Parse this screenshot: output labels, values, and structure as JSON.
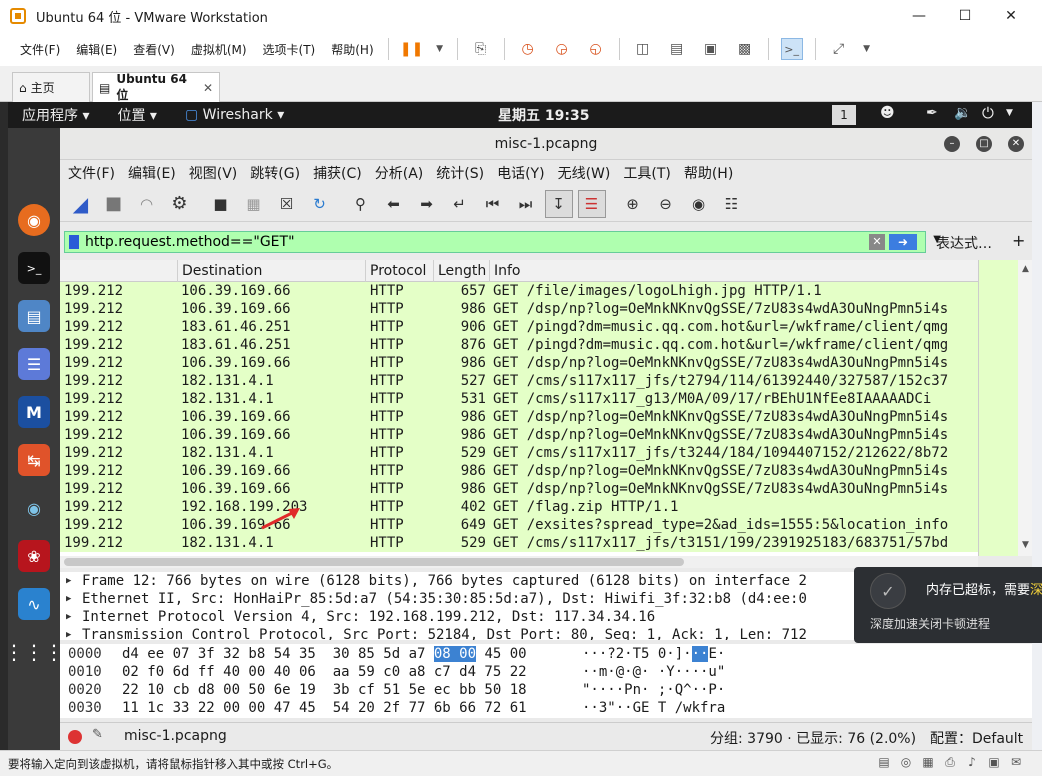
{
  "vmware": {
    "window_title": "Ubuntu 64 位 - VMware Workstation",
    "menu": [
      "文件(F)",
      "编辑(E)",
      "查看(V)",
      "虚拟机(M)",
      "选项卡(T)",
      "帮助(H)"
    ],
    "tabs": [
      {
        "label": "主页",
        "icon": "home-icon"
      },
      {
        "label": "Ubuntu 64 位",
        "icon": "vm-icon"
      }
    ],
    "status_hint": "要将输入定向到该虚拟机，请将鼠标指针移入其中或按 Ctrl+G。"
  },
  "ubuntu": {
    "applications": "应用程序 ▾",
    "places": "位置 ▾",
    "active_app": "Wireshark ▾",
    "clock": "星期五 19:35",
    "workspace": "1"
  },
  "wireshark": {
    "title": "misc-1.pcapng",
    "menu": [
      "文件(F)",
      "编辑(E)",
      "视图(V)",
      "跳转(G)",
      "捕获(C)",
      "分析(A)",
      "统计(S)",
      "电话(Y)",
      "无线(W)",
      "工具(T)",
      "帮助(H)"
    ],
    "filter": {
      "value": "http.request.method==\"GET\"",
      "expression_label": "表达式…",
      "add_label": "+"
    },
    "columns": [
      "Destination",
      "Protocol",
      "Length",
      "Info"
    ],
    "packets": [
      {
        "src": "199.212",
        "dst": "106.39.169.66",
        "proto": "HTTP",
        "len": "657",
        "info": "GET /file/images/logoLhigh.jpg HTTP/1.1"
      },
      {
        "src": "199.212",
        "dst": "106.39.169.66",
        "proto": "HTTP",
        "len": "986",
        "info": "GET /dsp/np?log=OeMnkNKnvQgSSE/7zU83s4wdA3OuNngPmn5i4s"
      },
      {
        "src": "199.212",
        "dst": "183.61.46.251",
        "proto": "HTTP",
        "len": "906",
        "info": "GET /pingd?dm=music.qq.com.hot&url=/wkframe/client/qmg"
      },
      {
        "src": "199.212",
        "dst": "183.61.46.251",
        "proto": "HTTP",
        "len": "876",
        "info": "GET /pingd?dm=music.qq.com.hot&url=/wkframe/client/qmg"
      },
      {
        "src": "199.212",
        "dst": "106.39.169.66",
        "proto": "HTTP",
        "len": "986",
        "info": "GET /dsp/np?log=OeMnkNKnvQgSSE/7zU83s4wdA3OuNngPmn5i4s"
      },
      {
        "src": "199.212",
        "dst": "182.131.4.1",
        "proto": "HTTP",
        "len": "527",
        "info": "GET /cms/s117x117_jfs/t2794/114/61392440/327587/152c37"
      },
      {
        "src": "199.212",
        "dst": "182.131.4.1",
        "proto": "HTTP",
        "len": "531",
        "info": "GET /cms/s117x117_g13/M0A/09/17/rBEhU1NfEe8IAAAAADCi"
      },
      {
        "src": "199.212",
        "dst": "106.39.169.66",
        "proto": "HTTP",
        "len": "986",
        "info": "GET /dsp/np?log=OeMnkNKnvQgSSE/7zU83s4wdA3OuNngPmn5i4s"
      },
      {
        "src": "199.212",
        "dst": "106.39.169.66",
        "proto": "HTTP",
        "len": "986",
        "info": "GET /dsp/np?log=OeMnkNKnvQgSSE/7zU83s4wdA3OuNngPmn5i4s"
      },
      {
        "src": "199.212",
        "dst": "182.131.4.1",
        "proto": "HTTP",
        "len": "529",
        "info": "GET /cms/s117x117_jfs/t3244/184/1094407152/212622/8b72"
      },
      {
        "src": "199.212",
        "dst": "106.39.169.66",
        "proto": "HTTP",
        "len": "986",
        "info": "GET /dsp/np?log=OeMnkNKnvQgSSE/7zU83s4wdA3OuNngPmn5i4s"
      },
      {
        "src": "199.212",
        "dst": "106.39.169.66",
        "proto": "HTTP",
        "len": "986",
        "info": "GET /dsp/np?log=OeMnkNKnvQgSSE/7zU83s4wdA3OuNngPmn5i4s"
      },
      {
        "src": "199.212",
        "dst": "192.168.199.203",
        "proto": "HTTP",
        "len": "402",
        "info": "GET /flag.zip HTTP/1.1"
      },
      {
        "src": "199.212",
        "dst": "106.39.169.66",
        "proto": "HTTP",
        "len": "649",
        "info": "GET /exsites?spread_type=2&ad_ids=1555:5&location_info"
      },
      {
        "src": "199.212",
        "dst": "182.131.4.1",
        "proto": "HTTP",
        "len": "529",
        "info": "GET /cms/s117x117_jfs/t3151/199/2391925183/683751/57bd"
      }
    ],
    "details": [
      "Frame 12: 766 bytes on wire (6128 bits), 766 bytes captured (6128 bits) on interface 2",
      "Ethernet II, Src: HonHaiPr_85:5d:a7 (54:35:30:85:5d:a7), Dst: Hiwifi_3f:32:b8 (d4:ee:0",
      "Internet Protocol Version 4, Src: 192.168.199.212, Dst: 117.34.34.16",
      "Transmission Control Protocol, Src Port: 52184, Dst Port: 80, Seq: 1, Ack: 1, Len: 712"
    ],
    "hex": [
      {
        "off": "0000",
        "pre": "d4 ee 07 3f 32 b8 54 35  30 85 5d a7 ",
        "hl": "08 00",
        "post": " 45 00",
        "apre": "···?2·T5 0·]·",
        "ahl": "··",
        "apost": "E·"
      },
      {
        "off": "0010",
        "pre": "02 f0 6d ff 40 00 40 06  aa 59 c0 a8 c7 d4 75 22",
        "hl": "",
        "post": "",
        "apre": "··m·@·@· ·Y····u\"",
        "ahl": "",
        "apost": ""
      },
      {
        "off": "0020",
        "pre": "22 10 cb d8 00 50 6e 19  3b cf 51 5e ec bb 50 18",
        "hl": "",
        "post": "",
        "apre": "\"····Pn· ;·Q^··P·",
        "ahl": "",
        "apost": ""
      },
      {
        "off": "0030",
        "pre": "11 1c 33 22 00 00 47 45  54 20 2f 77 6b 66 72 61",
        "hl": "",
        "post": "",
        "apre": "··3\"··GE T /wkfra",
        "ahl": "",
        "apost": ""
      }
    ],
    "status": {
      "file": "misc-1.pcapng",
      "stats": "分组: 3790 · 已显示: 76 (2.0%)",
      "profile": "配置：Default"
    }
  },
  "toast": {
    "message_prefix": "内存已超标，需要",
    "message_highlight": "深",
    "sub": "深度加速关闭卡顿进程"
  }
}
